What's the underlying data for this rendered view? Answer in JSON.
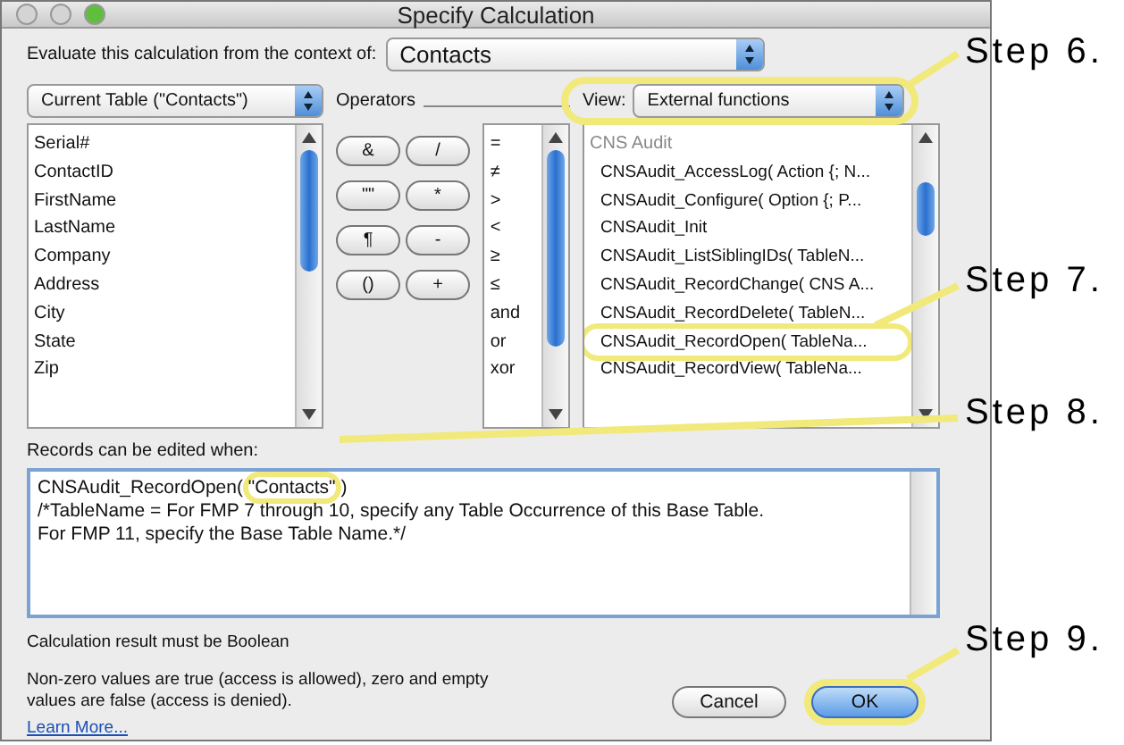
{
  "window": {
    "title": "Specify Calculation"
  },
  "context": {
    "label": "Evaluate this calculation from the context of:",
    "value": "Contacts"
  },
  "table_selector": {
    "value": "Current Table (\"Contacts\")"
  },
  "fields": [
    "Serial#",
    "ContactID",
    "FirstName",
    "LastName",
    "Company",
    "Address",
    "City",
    "State",
    "Zip"
  ],
  "operators": {
    "label": "Operators",
    "buttons": [
      "&",
      "/",
      "\"\"",
      "*",
      "¶",
      "-",
      "()",
      "+"
    ],
    "list": [
      "=",
      "≠",
      ">",
      "<",
      "≥",
      "≤",
      "and",
      "or",
      "xor"
    ]
  },
  "view": {
    "label": "View:",
    "value": "External functions",
    "callout": "Step 6."
  },
  "functions": {
    "group": "CNS Audit",
    "items": [
      {
        "text": "CNSAudit_AccessLog( Action {; N..."
      },
      {
        "text": "CNSAudit_Configure( Option {; P..."
      },
      {
        "text": "CNSAudit_Init"
      },
      {
        "text": "CNSAudit_ListSiblingIDs( TableN..."
      },
      {
        "text": "CNSAudit_RecordChange( CNS A..."
      },
      {
        "text": "CNSAudit_RecordDelete( TableN..."
      },
      {
        "text": "CNSAudit_RecordOpen( TableNa...",
        "callout": "Step 7."
      },
      {
        "text": "CNSAudit_RecordView( TableNa..."
      }
    ]
  },
  "formula": {
    "label": "Records can be edited when:",
    "lines": [
      {
        "parts": [
          {
            "text": "CNSAudit_RecordOpen( "
          },
          {
            "text": "\"Contacts\"",
            "callout": "Step 8."
          },
          {
            "text": " )"
          }
        ]
      },
      {
        "parts": [
          {
            "text": "/*TableName = For FMP 7 through 10, specify any Table Occurrence of this Base Table."
          }
        ]
      },
      {
        "parts": [
          {
            "text": "For FMP 11, specify the Base Table Name.*/"
          }
        ]
      }
    ]
  },
  "result_note": "Calculation result must be Boolean",
  "help_text": "Non-zero values are true (access is allowed), zero and empty values are false (access is denied).",
  "learn_more": "Learn More...",
  "buttons": [
    {
      "label": "Cancel",
      "kind": "normal"
    },
    {
      "label": "OK",
      "kind": "default",
      "callout": "Step 9."
    }
  ]
}
